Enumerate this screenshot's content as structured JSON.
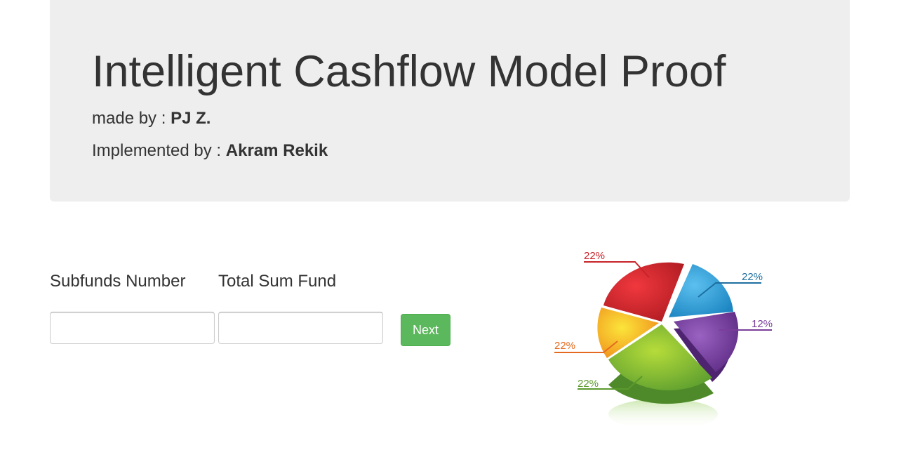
{
  "header": {
    "title": "Intelligent Cashflow Model Proof",
    "made_by_prefix": "made by : ",
    "made_by_name": "PJ Z.",
    "implemented_by_prefix": "Implemented by : ",
    "implemented_by_name": "Akram Rekik"
  },
  "form": {
    "subfunds_label": "Subfunds Number",
    "subfunds_value": "",
    "total_label": "Total Sum Fund",
    "total_value": "",
    "next_label": "Next"
  },
  "pie_illustration": {
    "slices": [
      {
        "label": "22%",
        "value": 22,
        "color": "#d7262d"
      },
      {
        "label": "22%",
        "value": 22,
        "color": "#33a4dc"
      },
      {
        "label": "12%",
        "value": 12,
        "color": "#7e4aa3"
      },
      {
        "label": "22%",
        "value": 22,
        "color": "#8cc43a"
      },
      {
        "label": "22%",
        "value": 22,
        "color": "#f3b31c"
      }
    ],
    "label_colors": {
      "red": "#c8232a",
      "blue": "#1d6fa0",
      "purple": "#7a3d9a",
      "orange": "#e56a1f",
      "green": "#5a9a2b"
    }
  }
}
